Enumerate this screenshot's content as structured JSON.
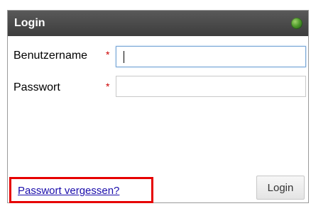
{
  "dialog": {
    "title": "Login",
    "status_icon": "green-globe-icon"
  },
  "form": {
    "username": {
      "label": "Benutzername",
      "required_marker": "*",
      "value": ""
    },
    "password": {
      "label": "Passwort",
      "required_marker": "*",
      "value": ""
    }
  },
  "footer": {
    "forgot_password_link": "Passwort vergessen?",
    "login_button": "Login"
  },
  "colors": {
    "titlebar": "#4a4a4a",
    "required": "#cc0000",
    "link": "#1a0dab",
    "highlight_box": "#e60000"
  }
}
